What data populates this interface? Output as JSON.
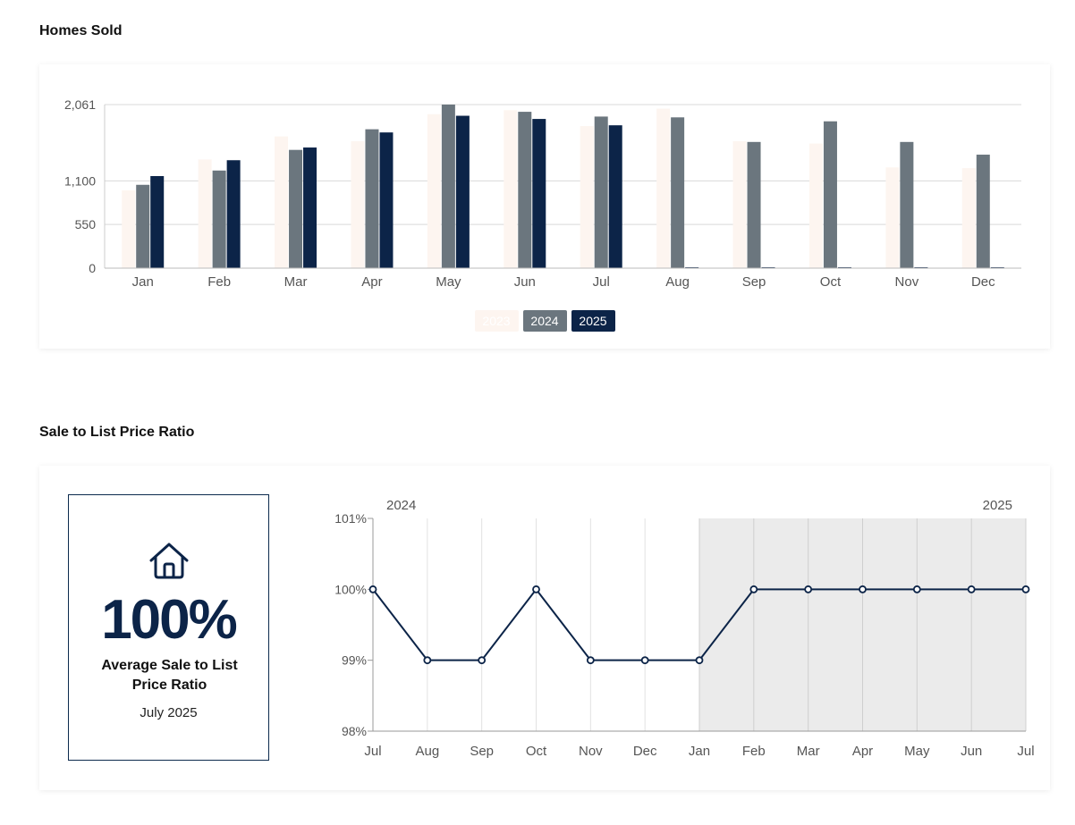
{
  "homes_sold": {
    "title": "Homes Sold",
    "legend": [
      {
        "label": "2023",
        "color": "#fdf5f0"
      },
      {
        "label": "2024",
        "color": "#6b767e"
      },
      {
        "label": "2025",
        "color": "#0c2448"
      }
    ]
  },
  "ratio": {
    "title": "Sale to List Price Ratio",
    "stat_value": "100%",
    "stat_label": "Average Sale to List Price Ratio",
    "stat_date": "July 2025",
    "icon": "house-icon",
    "year_start_label": "2024",
    "year_end_label": "2025",
    "line_color": "#0c2448",
    "shade_color": "#ebebeb"
  },
  "chart_data": [
    {
      "type": "bar",
      "title": "Homes Sold",
      "categories": [
        "Jan",
        "Feb",
        "Mar",
        "Apr",
        "May",
        "Jun",
        "Jul",
        "Aug",
        "Sep",
        "Oct",
        "Nov",
        "Dec"
      ],
      "yticks": [
        0,
        550,
        1100,
        2061
      ],
      "ytick_labels": [
        "0",
        "550",
        "1,100",
        "2,061"
      ],
      "ylim": [
        0,
        2061
      ],
      "grid": true,
      "legend_position": "bottom",
      "series": [
        {
          "name": "2023",
          "color": "#fdf5f0",
          "values": [
            980,
            1370,
            1660,
            1600,
            1940,
            1990,
            1790,
            2010,
            1600,
            1570,
            1270,
            1260
          ]
        },
        {
          "name": "2024",
          "color": "#6b767e",
          "values": [
            1050,
            1230,
            1490,
            1750,
            2061,
            1970,
            1910,
            1900,
            1590,
            1850,
            1590,
            1430
          ]
        },
        {
          "name": "2025",
          "color": "#0c2448",
          "values": [
            1160,
            1360,
            1520,
            1710,
            1920,
            1880,
            1800,
            0,
            0,
            0,
            0,
            0
          ]
        }
      ]
    },
    {
      "type": "line",
      "title": "",
      "x": [
        "Jul",
        "Aug",
        "Sep",
        "Oct",
        "Nov",
        "Dec",
        "Jan",
        "Feb",
        "Mar",
        "Apr",
        "May",
        "Jun",
        "Jul"
      ],
      "yticks": [
        98,
        99,
        100,
        101
      ],
      "ytick_labels": [
        "98%",
        "99%",
        "100%",
        "101%"
      ],
      "ylim": [
        98,
        101
      ],
      "grid": true,
      "shaded_from": "Jan",
      "series": [
        {
          "values": [
            100,
            99,
            99,
            100,
            99,
            99,
            99,
            100,
            100,
            100,
            100,
            100,
            100
          ]
        }
      ]
    }
  ]
}
